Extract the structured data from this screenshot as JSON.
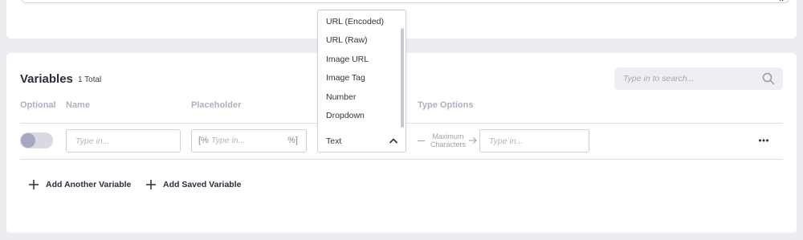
{
  "variables": {
    "title": "Variables",
    "total": "1 Total",
    "search_placeholder": "Type in to search...",
    "columns": {
      "optional": "Optional",
      "name": "Name",
      "placeholder": "Placeholder",
      "type_options": "Type Options"
    },
    "row": {
      "name_placeholder": "Type in...",
      "placeholder_prefix": "[%",
      "placeholder_input": "Type in...",
      "placeholder_suffix": "%]",
      "type_selected": "Text",
      "max_chars_line1": "Maximum",
      "max_chars_line2": "Characters",
      "max_chars_placeholder": "Type in..."
    },
    "type_dropdown_options": [
      "URL (Encoded)",
      "URL (Raw)",
      "Image URL",
      "Image Tag",
      "Number",
      "Dropdown"
    ],
    "actions": {
      "add_another": "Add Another Variable",
      "add_saved": "Add Saved Variable"
    }
  },
  "icons": {
    "resize": "resize-icon",
    "search": "search-icon",
    "chevron": "chevron-up-icon",
    "arrow": "arrow-right-icon",
    "more": "more-horizontal-icon",
    "plus": "plus-icon"
  },
  "colors": {
    "background": "#ededf1",
    "card": "#ffffff",
    "muted_text": "#b0b0bd",
    "toggle_knob": "#a6a8bf"
  }
}
